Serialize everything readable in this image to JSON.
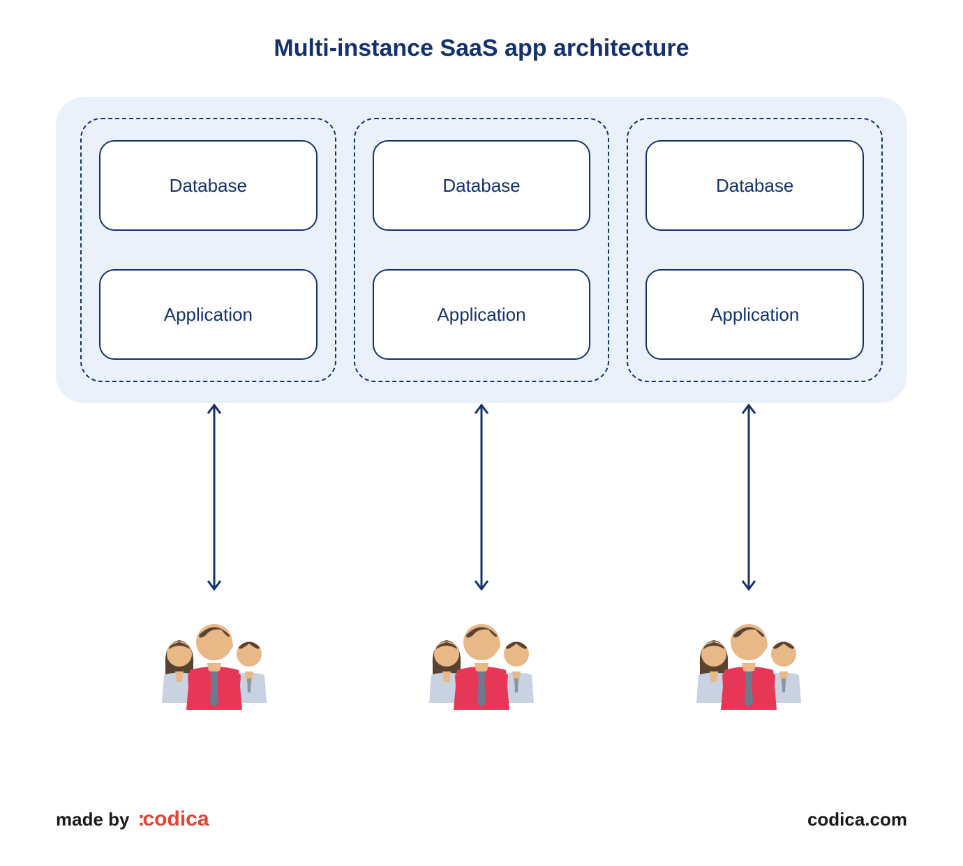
{
  "title": "Multi-instance SaaS app architecture",
  "instances": [
    {
      "database": "Database",
      "application": "Application"
    },
    {
      "database": "Database",
      "application": "Application"
    },
    {
      "database": "Database",
      "application": "Application"
    }
  ],
  "footer": {
    "made_by": "made by",
    "logo_text": "codica",
    "site": "codica.com"
  },
  "colors": {
    "primary": "#13326c",
    "container_bg": "#eaf1fb",
    "logo": "#e34234"
  }
}
